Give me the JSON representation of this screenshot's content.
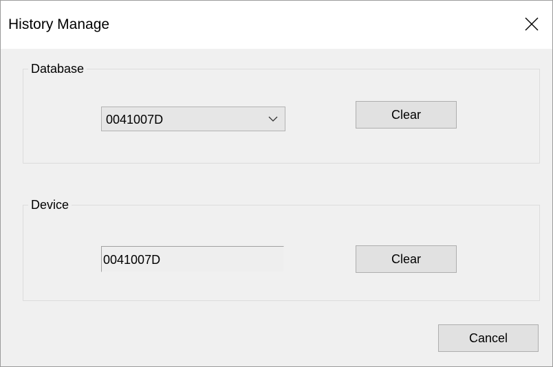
{
  "window": {
    "title": "History Manage",
    "close_icon": "close-icon"
  },
  "database": {
    "group_label": "Database",
    "selected_value": "0041007D",
    "dropdown_icon": "chevron-down-icon",
    "clear_label": "Clear"
  },
  "device": {
    "group_label": "Device",
    "field_value": "0041007D",
    "clear_label": "Clear"
  },
  "footer": {
    "cancel_label": "Cancel"
  }
}
